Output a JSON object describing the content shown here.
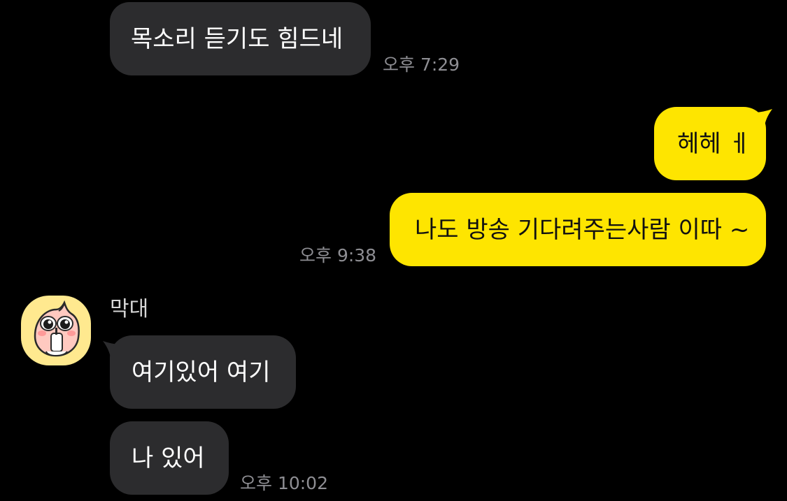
{
  "messages": [
    {
      "direction": "incoming",
      "text": "목소리 듣기도 힘드네",
      "time": "오후 7:29"
    },
    {
      "direction": "outgoing",
      "text": "헤헤 ㅔ"
    },
    {
      "direction": "outgoing",
      "text": "나도 방송 기다려주는사람 이따 ~",
      "time": "오후 9:38"
    },
    {
      "direction": "incoming",
      "sender": "막대",
      "text": "여기있어 여기"
    },
    {
      "direction": "incoming",
      "text": "나 있어",
      "time": "오후 10:02"
    }
  ],
  "colors": {
    "background": "#000000",
    "incoming_bubble": "#2c2c2e",
    "outgoing_bubble": "#fee500",
    "timestamp": "#8e8e93"
  },
  "icons": {
    "avatar": "peach-character-avatar-icon"
  }
}
